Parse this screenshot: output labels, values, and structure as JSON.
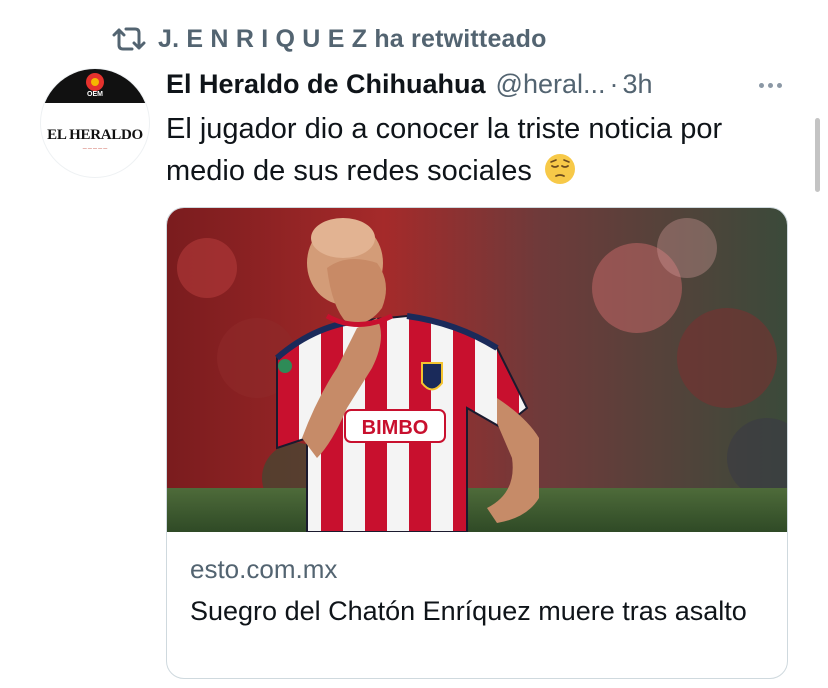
{
  "retweet": {
    "icon": "retweet-icon",
    "text": "J. E N R I Q U E Z ha retwitteado"
  },
  "tweet": {
    "avatar": {
      "icon": "el-heraldo-logo",
      "logo_text": "EL HERALDO",
      "badge_text": "OEM"
    },
    "author_name": "El Heraldo de Chihuahua",
    "author_handle": "@heral...",
    "separator": "·",
    "time": "3h",
    "more_icon": "more-horizontal-icon",
    "text": "El jugador dio a conocer la triste noticia por medio de sus redes sociales",
    "emoji": "pensive-face-emoji",
    "card": {
      "image_icon": "soccer-player-photo",
      "jersey_text": "BIMBO",
      "domain": "esto.com.mx",
      "title": "Suegro del Chatón Enríquez muere tras asalto"
    }
  },
  "colors": {
    "text_primary": "#0f1419",
    "text_secondary": "#536471",
    "border": "#cfd9de",
    "jersey_red": "#c8102e"
  }
}
